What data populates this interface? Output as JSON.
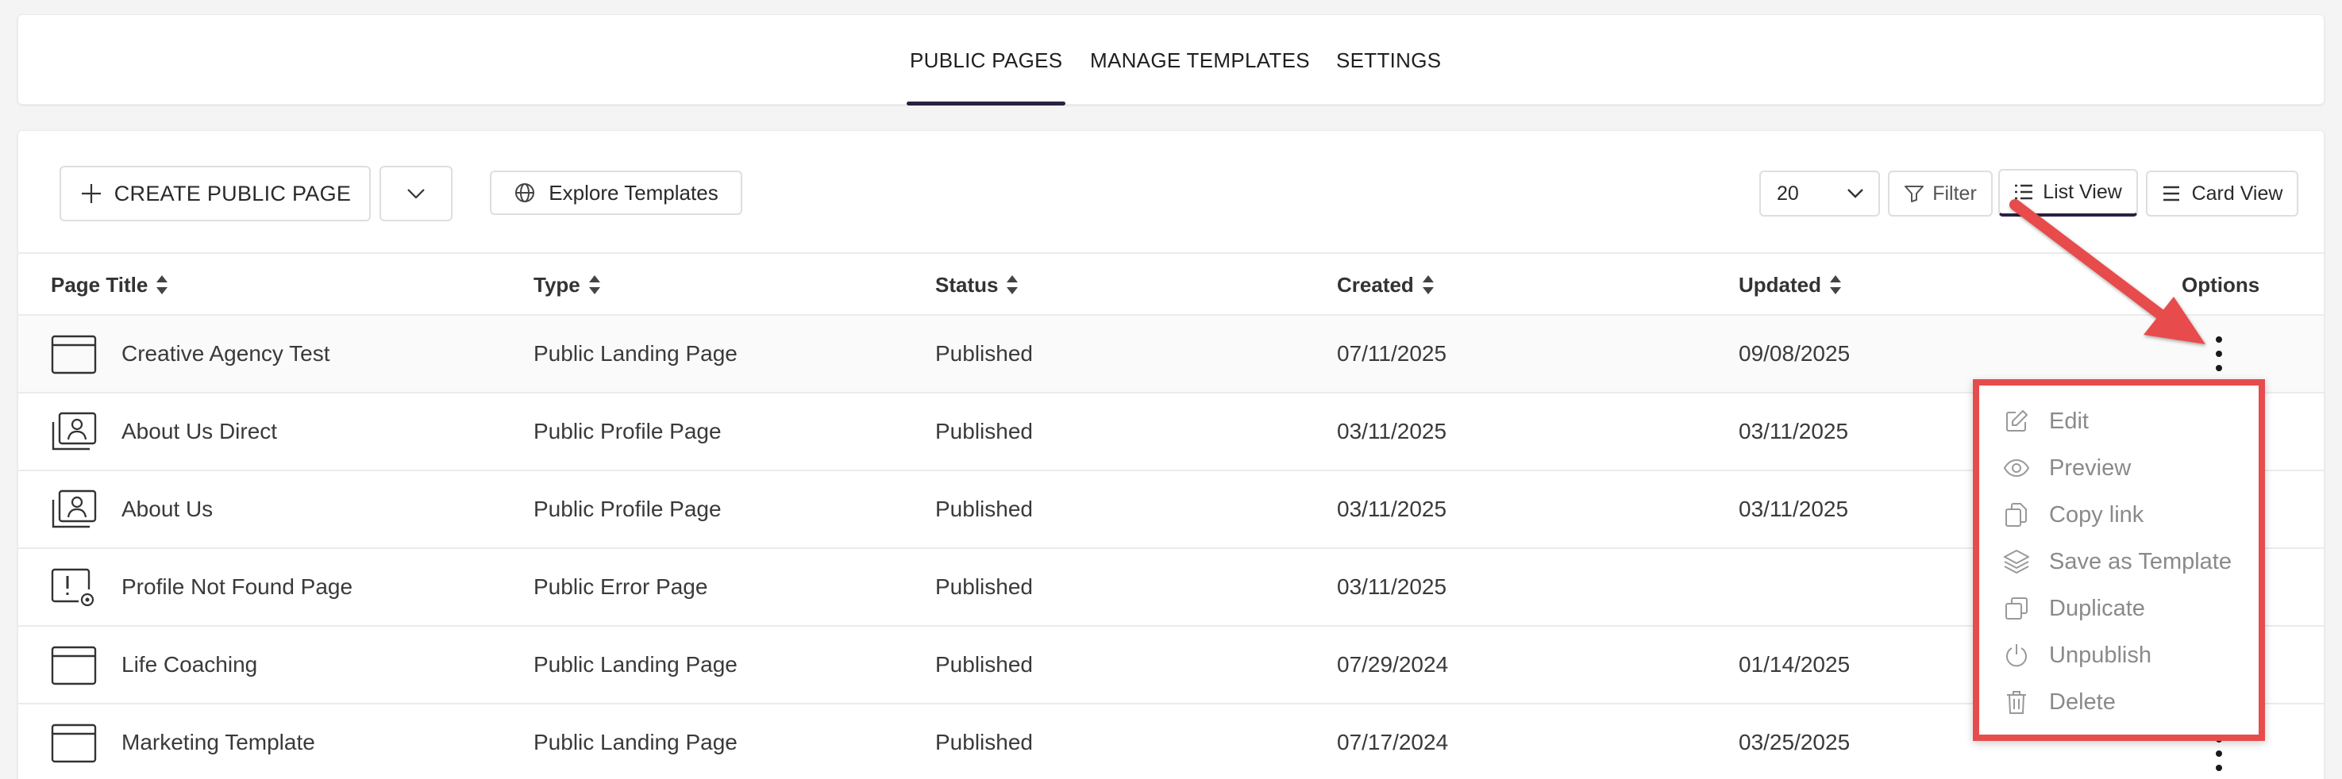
{
  "tabs": [
    {
      "label": "PUBLIC PAGES",
      "active": true
    },
    {
      "label": "MANAGE TEMPLATES",
      "active": false
    },
    {
      "label": "SETTINGS",
      "active": false
    }
  ],
  "toolbar": {
    "create_label": "CREATE PUBLIC PAGE",
    "explore_label": "Explore Templates",
    "page_size": "20",
    "filter_label": "Filter",
    "list_view_label": "List View",
    "card_view_label": "Card View"
  },
  "table": {
    "columns": [
      "Page Title",
      "Type",
      "Status",
      "Created",
      "Updated",
      "Options"
    ],
    "rows": [
      {
        "title": "Creative Agency Test",
        "type": "Public Landing Page",
        "status": "Published",
        "created": "07/11/2025",
        "updated": "09/08/2025",
        "icon": "browser-window-icon"
      },
      {
        "title": "About Us Direct",
        "type": "Public Profile Page",
        "status": "Published",
        "created": "03/11/2025",
        "updated": "03/11/2025",
        "icon": "profile-pages-icon"
      },
      {
        "title": "About Us",
        "type": "Public Profile Page",
        "status": "Published",
        "created": "03/11/2025",
        "updated": "03/11/2025",
        "icon": "profile-pages-icon"
      },
      {
        "title": "Profile Not Found Page",
        "type": "Public Error Page",
        "status": "Published",
        "created": "03/11/2025",
        "updated": "",
        "icon": "error-page-icon"
      },
      {
        "title": "Life Coaching",
        "type": "Public Landing Page",
        "status": "Published",
        "created": "07/29/2024",
        "updated": "01/14/2025",
        "icon": "browser-window-icon"
      },
      {
        "title": "Marketing Template",
        "type": "Public Landing Page",
        "status": "Published",
        "created": "07/17/2024",
        "updated": "03/25/2025",
        "icon": "browser-window-icon"
      }
    ]
  },
  "options_menu": {
    "items": [
      {
        "label": "Edit",
        "icon": "edit-icon"
      },
      {
        "label": "Preview",
        "icon": "eye-icon"
      },
      {
        "label": "Copy link",
        "icon": "copy-link-icon"
      },
      {
        "label": "Save as Template",
        "icon": "layers-icon"
      },
      {
        "label": "Duplicate",
        "icon": "duplicate-icon"
      },
      {
        "label": "Unpublish",
        "icon": "power-icon"
      },
      {
        "label": "Delete",
        "icon": "trash-icon"
      }
    ]
  },
  "colors": {
    "accent": "#2a2140",
    "highlight_border": "#e74c4c",
    "arrow": "#e74c4c"
  }
}
